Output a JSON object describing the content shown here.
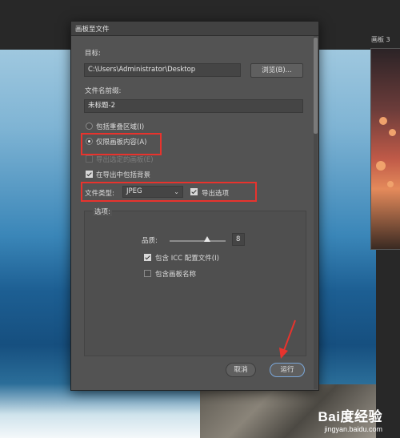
{
  "canvas": {
    "artboard_label": "画板 3"
  },
  "dialog": {
    "title": "画板至文件",
    "destination": {
      "label": "目标:",
      "value": "C:\\Users\\Administrator\\Desktop",
      "browse_button": "浏览(B)..."
    },
    "prefix": {
      "label": "文件名前缀:",
      "value": "未标题-2"
    },
    "options_top": [
      {
        "type": "radio",
        "label": "包括重叠区域(I)",
        "checked": false
      },
      {
        "type": "radio",
        "label": "仅限画板内容(A)",
        "checked": true
      },
      {
        "type": "checkbox",
        "label": "导出选定的画板(E)",
        "checked": false,
        "disabled": true
      },
      {
        "type": "checkbox",
        "label": "在导出中包括背景",
        "checked": true
      }
    ],
    "file_type": {
      "label": "文件类型:",
      "value": "JPEG",
      "export_options_label": "导出选项",
      "export_options_checked": true
    },
    "options_group": {
      "title": "选项:",
      "quality_label": "品质:",
      "quality_value": "8",
      "quality_max": 12,
      "include_icc_label": "包含 ICC 配置文件(I)",
      "include_icc_checked": true,
      "include_artboard_name_label": "包含画板名称",
      "include_artboard_name_checked": false
    },
    "buttons": {
      "cancel": "取消",
      "run": "运行"
    }
  },
  "watermark": {
    "logo": "Bai度经验",
    "url": "jingyan.baidu.com"
  },
  "colors": {
    "highlight": "#e8332d",
    "dialog_bg": "#535353"
  }
}
